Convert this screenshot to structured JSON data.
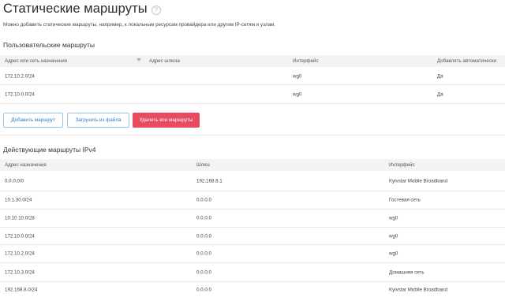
{
  "page": {
    "title": "Статические маршруты",
    "help_icon": "?",
    "description": "Можно добавить статические маршруты, например, к локальным ресурсам провайдера или другим IP-сетям и узлам."
  },
  "user_routes": {
    "section_title": "Пользовательские маршруты",
    "columns": [
      "Адрес или сеть назначения",
      "Адрес шлюза",
      "Интерфейс",
      "Добавлять автоматически"
    ],
    "rows": [
      [
        "172.10.2.0/24",
        "",
        "wg0",
        "Да"
      ],
      [
        "172.10.0.0/24",
        "",
        "wg0",
        "Да"
      ]
    ]
  },
  "buttons": {
    "add_route": "Добавить маршрут",
    "load_from_file": "Загрузить из файла",
    "delete_all": "Удалить все маршруты"
  },
  "active_routes": {
    "section_title": "Действующие маршруты IPv4",
    "columns": [
      "Адрес назначения",
      "Шлюз",
      "Интерфейс"
    ],
    "rows": [
      [
        "0.0.0.0/0",
        "192.168.8.1",
        "Kyivstar Mobile Broadband"
      ],
      [
        "10.1.30.0/24",
        "0.0.0.0",
        "Гостевая сеть"
      ],
      [
        "10.10.10.0/28",
        "0.0.0.0",
        "wg0"
      ],
      [
        "172.10.0.0/24",
        "0.0.0.0",
        "wg0"
      ],
      [
        "172.10.2.0/24",
        "0.0.0.0",
        "wg0"
      ],
      [
        "172.10.3.0/24",
        "0.0.0.0",
        "Домашняя сеть"
      ],
      [
        "192.168.8.0/24",
        "0.0.0.0",
        "Kyivstar Mobile Broadband"
      ]
    ]
  },
  "colors": {
    "accent": "#2f7bbf",
    "danger": "#e84a5f",
    "header_bg": "#f3f3f3"
  }
}
